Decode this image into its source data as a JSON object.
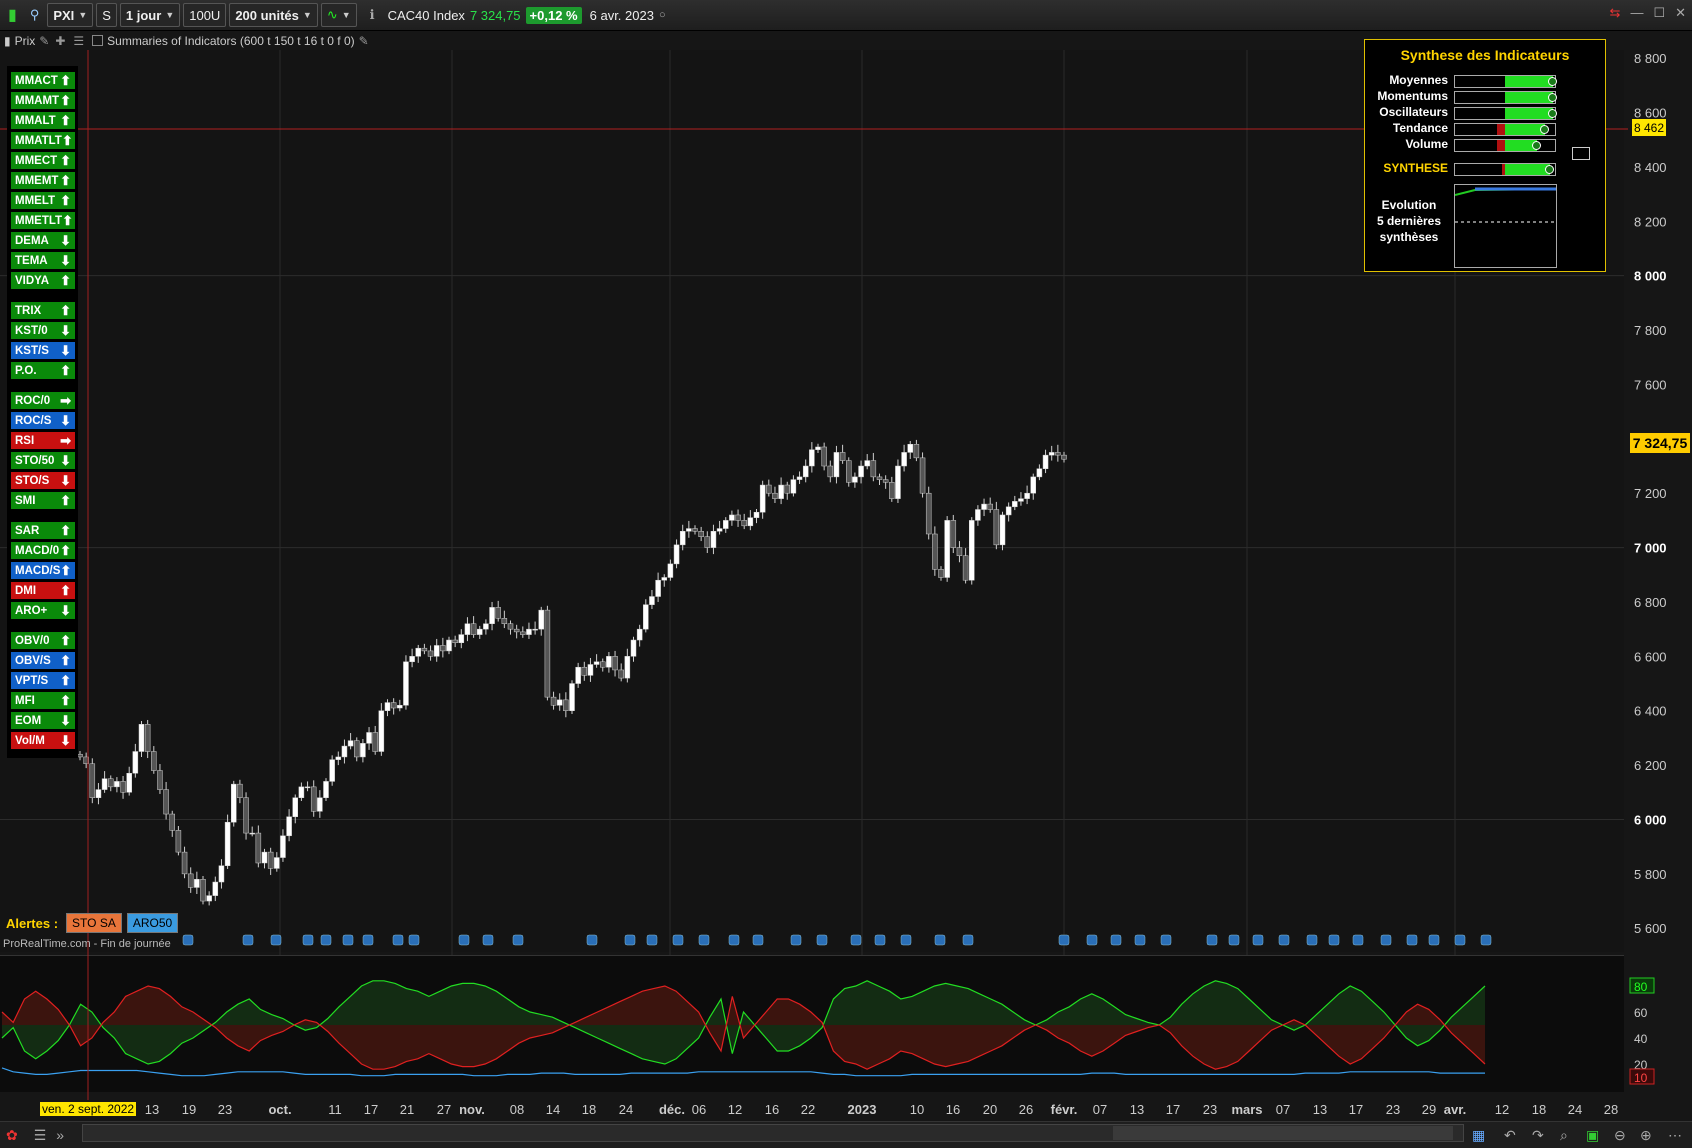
{
  "toolbar": {
    "symbol": "PXI",
    "s_label": "S",
    "period": "1 jour",
    "units_btn": "100U",
    "units": "200 unités",
    "instrument": "CAC40 Index",
    "price": "7 324,75",
    "change": "+0,12 %",
    "date": "6 avr. 2023"
  },
  "subbar": {
    "price_label": "Prix",
    "indicator_label": "Summaries of Indicators (600 t 150 t 16 t 0 f 0)"
  },
  "indicators": [
    {
      "label": "MMACT",
      "color": "#0a8a0a",
      "arrow": "up"
    },
    {
      "label": "MMAMT",
      "color": "#0a8a0a",
      "arrow": "up"
    },
    {
      "label": "MMALT",
      "color": "#0a8a0a",
      "arrow": "up"
    },
    {
      "label": "MMATLT",
      "color": "#0a8a0a",
      "arrow": "up"
    },
    {
      "label": "MMECT",
      "color": "#0a8a0a",
      "arrow": "up"
    },
    {
      "label": "MMEMT",
      "color": "#0a8a0a",
      "arrow": "up"
    },
    {
      "label": "MMELT",
      "color": "#0a8a0a",
      "arrow": "up"
    },
    {
      "label": "MMETLT",
      "color": "#0a8a0a",
      "arrow": "up"
    },
    {
      "label": "DEMA",
      "color": "#0a8a0a",
      "arrow": "down"
    },
    {
      "label": "TEMA",
      "color": "#0a8a0a",
      "arrow": "down"
    },
    {
      "label": "VIDYA",
      "color": "#0a8a0a",
      "arrow": "up"
    },
    {
      "label": "TRIX",
      "color": "#0a8a0a",
      "arrow": "up"
    },
    {
      "label": "KST/0",
      "color": "#0a8a0a",
      "arrow": "down"
    },
    {
      "label": "KST/S",
      "color": "#1060c8",
      "arrow": "down"
    },
    {
      "label": "P.O.",
      "color": "#0a8a0a",
      "arrow": "up"
    },
    {
      "label": "ROC/0",
      "color": "#0a8a0a",
      "arrow": "right"
    },
    {
      "label": "ROC/S",
      "color": "#1060c8",
      "arrow": "down"
    },
    {
      "label": "RSI",
      "color": "#c81010",
      "arrow": "right"
    },
    {
      "label": "STO/50",
      "color": "#0a8a0a",
      "arrow": "down"
    },
    {
      "label": "STO/S",
      "color": "#c81010",
      "arrow": "down"
    },
    {
      "label": "SMI",
      "color": "#0a8a0a",
      "arrow": "up"
    },
    {
      "label": "SAR",
      "color": "#0a8a0a",
      "arrow": "up"
    },
    {
      "label": "MACD/0",
      "color": "#0a8a0a",
      "arrow": "up"
    },
    {
      "label": "MACD/S",
      "color": "#1060c8",
      "arrow": "up"
    },
    {
      "label": "DMI",
      "color": "#c81010",
      "arrow": "up"
    },
    {
      "label": "ARO+",
      "color": "#0a8a0a",
      "arrow": "down"
    },
    {
      "label": "OBV/0",
      "color": "#0a8a0a",
      "arrow": "up"
    },
    {
      "label": "OBV/S",
      "color": "#1060c8",
      "arrow": "up"
    },
    {
      "label": "VPT/S",
      "color": "#1060c8",
      "arrow": "up"
    },
    {
      "label": "MFI",
      "color": "#0a8a0a",
      "arrow": "up"
    },
    {
      "label": "EOM",
      "color": "#0a8a0a",
      "arrow": "down"
    },
    {
      "label": "Vol/M",
      "color": "#c81010",
      "arrow": "down"
    }
  ],
  "synthese": {
    "title": "Synthese des Indicateurs",
    "rows": [
      {
        "label": "Moyennes",
        "value": 0.98,
        "neg": 0.0
      },
      {
        "label": "Momentums",
        "value": 0.98,
        "neg": 0.0
      },
      {
        "label": "Oscillateurs",
        "value": 0.98,
        "neg": 0.0
      },
      {
        "label": "Tendance",
        "value": 0.9,
        "neg": 0.08
      },
      {
        "label": "Volume",
        "value": 0.82,
        "neg": 0.08
      },
      {
        "label": "SYNTHESE",
        "value": 0.95,
        "neg": 0.03
      }
    ],
    "evolution_label": [
      "Evolution",
      "5 dernières",
      "synthèses"
    ]
  },
  "alerts": {
    "label": "Alertes :",
    "items": [
      {
        "text": "STO SA",
        "color": "#e8753a"
      },
      {
        "text": "ARO50",
        "color": "#3a9be0"
      }
    ]
  },
  "source_text": "ProRealTime.com - Fin de journée",
  "crosshair_date": "ven. 2 sept. 2022",
  "chart_data": [
    {
      "type": "candlestick",
      "title": "CAC40 Index",
      "y_ticks": [
        5600,
        5800,
        6000,
        6200,
        6400,
        6600,
        6800,
        7000,
        7200,
        7400,
        7600,
        7800,
        8000,
        8200,
        8400,
        8600,
        8800
      ],
      "ylim": [
        5520,
        8830
      ],
      "x_tick_labels": [
        "13",
        "19",
        "23",
        "oct.",
        "11",
        "17",
        "21",
        "27",
        "nov.",
        "08",
        "14",
        "18",
        "24",
        "déc.",
        "06",
        "12",
        "16",
        "22",
        "2023",
        "10",
        "16",
        "20",
        "26",
        "févr.",
        "07",
        "13",
        "17",
        "23",
        "mars",
        "07",
        "13",
        "17",
        "23",
        "29",
        "avr.",
        "12",
        "18",
        "24",
        "28"
      ],
      "last_price": "7 324,75",
      "crosshair_price": "8 462",
      "close": [
        6230,
        6205,
        6080,
        6110,
        6150,
        6120,
        6140,
        6100,
        6170,
        6250,
        6350,
        6250,
        6180,
        6110,
        6020,
        5960,
        5880,
        5800,
        5750,
        5780,
        5700,
        5720,
        5770,
        5830,
        5990,
        6130,
        6080,
        5950,
        5950,
        5840,
        5880,
        5820,
        5860,
        5940,
        6010,
        6080,
        6120,
        6120,
        6030,
        6080,
        6140,
        6220,
        6230,
        6270,
        6290,
        6230,
        6280,
        6320,
        6250,
        6400,
        6430,
        6410,
        6420,
        6580,
        6600,
        6630,
        6620,
        6600,
        6640,
        6620,
        6660,
        6650,
        6680,
        6720,
        6680,
        6700,
        6720,
        6780,
        6740,
        6720,
        6700,
        6690,
        6680,
        6700,
        6700,
        6770,
        6450,
        6420,
        6440,
        6400,
        6500,
        6560,
        6530,
        6570,
        6580,
        6560,
        6600,
        6550,
        6520,
        6600,
        6660,
        6700,
        6790,
        6820,
        6880,
        6890,
        6940,
        7010,
        7060,
        7070,
        7060,
        7040,
        7000,
        7060,
        7070,
        7100,
        7120,
        7100,
        7080,
        7110,
        7130,
        7230,
        7200,
        7180,
        7230,
        7200,
        7250,
        7260,
        7300,
        7360,
        7370,
        7300,
        7260,
        7350,
        7320,
        7240,
        7260,
        7300,
        7320,
        7260,
        7250,
        7240,
        7180,
        7300,
        7350,
        7380,
        7330,
        7200,
        7050,
        6920,
        6890,
        7100,
        7000,
        6970,
        6880,
        7100,
        7140,
        7160,
        7140,
        7010,
        7120,
        7150,
        7170,
        7180,
        7200,
        7260,
        7290,
        7340,
        7350,
        7340,
        7325
      ],
      "rsi_ticks": [
        80,
        60,
        40,
        20,
        10
      ],
      "rsi_green": [
        40,
        48,
        30,
        24,
        30,
        38,
        50,
        66,
        60,
        48,
        40,
        28,
        24,
        20,
        22,
        28,
        36,
        40,
        46,
        52,
        60,
        66,
        70,
        62,
        58,
        55,
        50,
        46,
        48,
        55,
        64,
        72,
        80,
        84,
        84,
        82,
        78,
        76,
        72,
        76,
        80,
        82,
        82,
        80,
        76,
        70,
        64,
        60,
        58,
        56,
        52,
        48,
        44,
        40,
        36,
        32,
        28,
        24,
        22,
        20,
        24,
        32,
        40,
        56,
        70,
        28,
        60,
        50,
        40,
        30,
        30,
        34,
        40,
        48,
        70,
        78,
        80,
        84,
        80,
        76,
        70,
        72,
        76,
        80,
        82,
        80,
        78,
        74,
        70,
        66,
        60,
        54,
        50,
        54,
        60,
        64,
        70,
        74,
        70,
        64,
        58,
        55,
        52,
        50,
        56,
        66,
        74,
        80,
        84,
        82,
        78,
        70,
        62,
        54,
        50,
        46,
        50,
        58,
        66,
        74,
        80,
        76,
        68,
        60,
        50,
        40,
        34,
        38,
        46,
        56,
        64,
        72,
        80
      ],
      "rsi_red": [
        60,
        52,
        70,
        76,
        70,
        62,
        50,
        34,
        40,
        52,
        60,
        72,
        76,
        80,
        78,
        72,
        64,
        60,
        54,
        48,
        40,
        34,
        30,
        38,
        42,
        45,
        50,
        54,
        52,
        45,
        36,
        28,
        20,
        16,
        16,
        18,
        22,
        24,
        28,
        24,
        20,
        18,
        18,
        20,
        24,
        30,
        36,
        40,
        42,
        44,
        48,
        52,
        56,
        60,
        64,
        68,
        72,
        76,
        78,
        80,
        76,
        68,
        60,
        44,
        30,
        72,
        40,
        50,
        60,
        70,
        70,
        66,
        60,
        52,
        30,
        22,
        20,
        16,
        20,
        24,
        30,
        28,
        24,
        20,
        18,
        20,
        22,
        26,
        30,
        34,
        40,
        46,
        50,
        46,
        40,
        36,
        30,
        26,
        30,
        36,
        42,
        45,
        48,
        50,
        44,
        34,
        26,
        20,
        16,
        18,
        22,
        30,
        38,
        46,
        50,
        54,
        50,
        42,
        34,
        26,
        20,
        24,
        32,
        40,
        50,
        60,
        66,
        62,
        54,
        44,
        36,
        28,
        20
      ],
      "rsi_blue": [
        17,
        14,
        13,
        12,
        12,
        13,
        14,
        15,
        15,
        15,
        15,
        15,
        15,
        14,
        13,
        12,
        11,
        11,
        11,
        12,
        13,
        14,
        14,
        14,
        14,
        14,
        13,
        12,
        12,
        12,
        12,
        12,
        11,
        11,
        11,
        12,
        12,
        12,
        12,
        12,
        12,
        12,
        11,
        11,
        11,
        12,
        12,
        12,
        13,
        13,
        13,
        12,
        12,
        12,
        12,
        12,
        13,
        13,
        13,
        13,
        13,
        13,
        14,
        14,
        14,
        14,
        14,
        14,
        14,
        14,
        14,
        14,
        14,
        13,
        12,
        12,
        11,
        11,
        11,
        11,
        11,
        12,
        12,
        12,
        12,
        12,
        12,
        12,
        12,
        12,
        12,
        12,
        12,
        12,
        12,
        12,
        12,
        13,
        13,
        13,
        12,
        12,
        12,
        12,
        12,
        12,
        12,
        12,
        12,
        12,
        12,
        12,
        12,
        12,
        12,
        12,
        13,
        13,
        13,
        13,
        14,
        14,
        14,
        14,
        14,
        14,
        14,
        14,
        13,
        13,
        13,
        13,
        13
      ]
    }
  ]
}
